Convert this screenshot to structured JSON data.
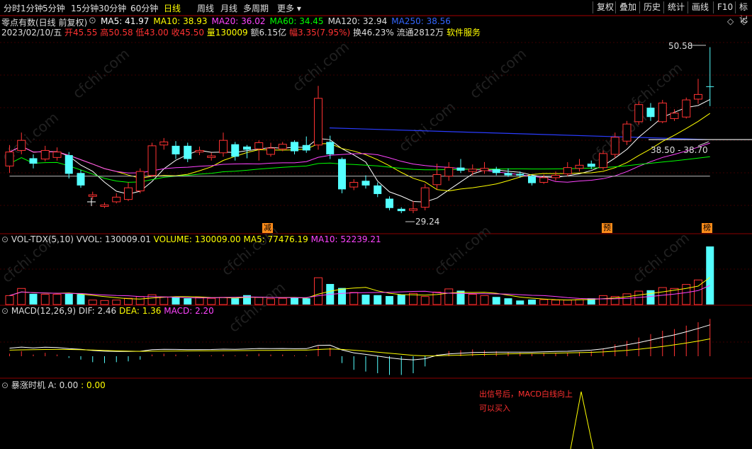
{
  "toolbar": {
    "periods": [
      "分时",
      "1分钟",
      "5分钟",
      "15分钟",
      "30分钟",
      "60分钟",
      "日线",
      "周线",
      "月线",
      "多周期",
      "更多"
    ],
    "active": "日线",
    "right_buttons": [
      "复权",
      "叠加",
      "历史",
      "统计",
      "画线",
      "F10",
      "标记"
    ]
  },
  "stock": {
    "name_line": "零点有数(日线 前复权)",
    "ma_labels": [
      {
        "text": "MA5: 41.97",
        "color": "#ffffff"
      },
      {
        "text": "MA10: 38.93",
        "color": "#ffff00"
      },
      {
        "text": "MA20: 36.02",
        "color": "#ff44ff"
      },
      {
        "text": "MA60: 34.45",
        "color": "#00ff00"
      },
      {
        "text": "MA120: 32.94",
        "color": "#dddddd"
      },
      {
        "text": "MA250: 38.56",
        "color": "#3366ff"
      }
    ],
    "date": "2023/02/10/五",
    "open": "开45.55",
    "high": "高50.58",
    "low": "低43.00",
    "close": "收45.50",
    "volume": "量130009",
    "amount": "额6.15亿",
    "amplitude": "幅3.35(7.95%)",
    "turnover": "换46.23%",
    "float": "流通2812万",
    "service": "软件服务"
  },
  "price_annotations": {
    "high": "50.58",
    "low": "29.24",
    "range": "38.50 - 38.70"
  },
  "badges": [
    "减",
    "预",
    "榜"
  ],
  "vol_panel": {
    "name": "VOL-TDX(5,10)",
    "vvol": "VVOL: 130009.01",
    "volume": "VOLUME: 130009.00",
    "ma5": "MA5: 77476.19",
    "ma10": "MA10: 52239.21"
  },
  "macd_panel": {
    "name": "MACD(12,26,9)",
    "dif": "DIF: 2.46",
    "dea": "DEA: 1.36",
    "macd": "MACD: 2.20"
  },
  "signal_panel": {
    "name": "暴涨时机",
    "a_label": "A: 0.00",
    "a_value": ": 0.00",
    "note1": "出信号后，MACD白线向上",
    "note2": "可以买入"
  },
  "watermark": "cfchi.com",
  "colors": {
    "up": "#ff3232",
    "down": "#54ffff",
    "bg": "#000000",
    "grid": "#8b0000"
  },
  "chart_data": {
    "type": "candlestick",
    "candles": [
      {
        "o": 35.3,
        "c": 37.1,
        "h": 38.0,
        "l": 34.4
      },
      {
        "o": 37.3,
        "c": 38.6,
        "h": 39.6,
        "l": 36.8
      },
      {
        "o": 36.3,
        "c": 35.6,
        "h": 36.8,
        "l": 35.0
      },
      {
        "o": 36.2,
        "c": 37.3,
        "h": 37.9,
        "l": 35.9
      },
      {
        "o": 36.4,
        "c": 37.1,
        "h": 37.7,
        "l": 36.0
      },
      {
        "o": 36.7,
        "c": 34.3,
        "h": 37.1,
        "l": 33.7
      },
      {
        "o": 34.4,
        "c": 32.8,
        "h": 34.8,
        "l": 32.5
      },
      {
        "o": 31.4,
        "c": 31.6,
        "h": 32.0,
        "l": 31.0
      },
      {
        "o": 30.1,
        "c": 30.3,
        "h": 30.6,
        "l": 29.9
      },
      {
        "o": 30.7,
        "c": 31.3,
        "h": 31.8,
        "l": 30.5
      },
      {
        "o": 31.0,
        "c": 32.5,
        "h": 33.2,
        "l": 30.8
      },
      {
        "o": 32.1,
        "c": 34.6,
        "h": 35.0,
        "l": 31.8
      },
      {
        "o": 34.1,
        "c": 37.9,
        "h": 38.3,
        "l": 33.9
      },
      {
        "o": 38.0,
        "c": 38.4,
        "h": 38.9,
        "l": 37.4
      },
      {
        "o": 37.9,
        "c": 36.8,
        "h": 38.5,
        "l": 36.2
      },
      {
        "o": 37.9,
        "c": 36.2,
        "h": 38.3,
        "l": 35.8
      },
      {
        "o": 37.1,
        "c": 37.3,
        "h": 37.8,
        "l": 36.7
      },
      {
        "o": 36.4,
        "c": 36.6,
        "h": 37.0,
        "l": 36.0
      },
      {
        "o": 37.0,
        "c": 38.6,
        "h": 39.6,
        "l": 36.5
      },
      {
        "o": 38.1,
        "c": 36.5,
        "h": 38.4,
        "l": 36.0
      },
      {
        "o": 37.8,
        "c": 37.4,
        "h": 38.0,
        "l": 36.3
      },
      {
        "o": 37.5,
        "c": 38.3,
        "h": 38.6,
        "l": 36.0
      },
      {
        "o": 36.8,
        "c": 37.6,
        "h": 38.3,
        "l": 36.5
      },
      {
        "o": 37.5,
        "c": 38.1,
        "h": 38.4,
        "l": 37.2
      },
      {
        "o": 38.4,
        "c": 37.2,
        "h": 38.6,
        "l": 36.8
      },
      {
        "o": 38.0,
        "c": 37.3,
        "h": 39.1,
        "l": 37.0
      },
      {
        "o": 38.0,
        "c": 44.0,
        "h": 45.6,
        "l": 37.4
      },
      {
        "o": 38.4,
        "c": 36.8,
        "h": 39.2,
        "l": 36.2
      },
      {
        "o": 36.2,
        "c": 32.3,
        "h": 36.4,
        "l": 31.8
      },
      {
        "o": 32.6,
        "c": 33.2,
        "h": 33.6,
        "l": 32.2
      },
      {
        "o": 33.4,
        "c": 32.8,
        "h": 34.1,
        "l": 32.4
      },
      {
        "o": 32.8,
        "c": 31.7,
        "h": 33.2,
        "l": 31.3
      },
      {
        "o": 31.1,
        "c": 29.9,
        "h": 31.4,
        "l": 29.6
      },
      {
        "o": 29.8,
        "c": 29.5,
        "h": 30.0,
        "l": 29.24
      },
      {
        "o": 29.6,
        "c": 29.8,
        "h": 30.8,
        "l": 29.24
      },
      {
        "o": 30.0,
        "c": 32.5,
        "h": 33.0,
        "l": 29.6
      },
      {
        "o": 32.9,
        "c": 34.2,
        "h": 35.6,
        "l": 32.3
      },
      {
        "o": 34.0,
        "c": 35.1,
        "h": 35.8,
        "l": 33.4
      },
      {
        "o": 35.1,
        "c": 34.7,
        "h": 36.2,
        "l": 34.4
      },
      {
        "o": 34.6,
        "c": 34.9,
        "h": 35.5,
        "l": 34.1
      },
      {
        "o": 34.7,
        "c": 35.0,
        "h": 35.8,
        "l": 34.3
      },
      {
        "o": 34.9,
        "c": 34.4,
        "h": 35.2,
        "l": 34.1
      },
      {
        "o": 34.4,
        "c": 34.1,
        "h": 35.0,
        "l": 33.9
      },
      {
        "o": 34.3,
        "c": 34.1,
        "h": 34.6,
        "l": 33.8
      },
      {
        "o": 34.0,
        "c": 33.1,
        "h": 34.2,
        "l": 32.8
      },
      {
        "o": 33.2,
        "c": 33.8,
        "h": 34.2,
        "l": 33.0
      },
      {
        "o": 33.8,
        "c": 34.1,
        "h": 34.6,
        "l": 33.4
      },
      {
        "o": 34.3,
        "c": 35.1,
        "h": 35.8,
        "l": 34.0
      },
      {
        "o": 35.0,
        "c": 35.4,
        "h": 36.2,
        "l": 34.6
      },
      {
        "o": 35.6,
        "c": 35.2,
        "h": 36.0,
        "l": 34.9
      },
      {
        "o": 35.1,
        "c": 36.9,
        "h": 37.3,
        "l": 34.8
      },
      {
        "o": 36.8,
        "c": 39.0,
        "h": 39.6,
        "l": 36.3
      },
      {
        "o": 38.5,
        "c": 40.7,
        "h": 41.1,
        "l": 38.0
      },
      {
        "o": 41.0,
        "c": 43.2,
        "h": 43.6,
        "l": 40.6
      },
      {
        "o": 42.8,
        "c": 41.6,
        "h": 43.4,
        "l": 41.1
      },
      {
        "o": 41.0,
        "c": 43.4,
        "h": 43.8,
        "l": 40.8
      },
      {
        "o": 41.4,
        "c": 42.1,
        "h": 42.6,
        "l": 41.1
      },
      {
        "o": 41.6,
        "c": 43.8,
        "h": 44.1,
        "l": 41.4
      },
      {
        "o": 43.9,
        "c": 44.5,
        "h": 46.5,
        "l": 43.3
      },
      {
        "o": 45.55,
        "c": 45.5,
        "h": 50.58,
        "l": 43.0
      }
    ],
    "volume": [
      20,
      36,
      24,
      23,
      23,
      24,
      23,
      10,
      9,
      10,
      14,
      18,
      22,
      17,
      17,
      14,
      16,
      14,
      16,
      14,
      21,
      16,
      13,
      14,
      15,
      14,
      60,
      46,
      37,
      27,
      22,
      21,
      19,
      22,
      25,
      18,
      28,
      35,
      31,
      23,
      20,
      17,
      14,
      9,
      11,
      11,
      10,
      10,
      11,
      14,
      20,
      18,
      24,
      30,
      32,
      38,
      36,
      45,
      55,
      130
    ],
    "vol_max": 130009,
    "macd_bars": [
      0.15,
      0.3,
      0.1,
      0.2,
      0.1,
      -0.1,
      -0.2,
      -0.35,
      -0.4,
      -0.35,
      -0.3,
      -0.2,
      0.1,
      0.15,
      0.1,
      0.05,
      0.05,
      0.05,
      0.1,
      0.05,
      0.1,
      0.15,
      0.1,
      0.1,
      0.05,
      0.05,
      0.6,
      0.5,
      -0.4,
      -0.8,
      -0.9,
      -1.0,
      -1.1,
      -1.1,
      -1.0,
      -0.6,
      0.1,
      0.3,
      0.35,
      0.4,
      0.35,
      0.3,
      0.25,
      0.2,
      0.15,
      0.2,
      0.2,
      0.2,
      0.25,
      0.3,
      0.45,
      0.7,
      0.9,
      1.1,
      1.3,
      1.5,
      1.6,
      1.8,
      2.0,
      2.2
    ],
    "dif_last": 2.46,
    "dea_last": 1.36
  }
}
